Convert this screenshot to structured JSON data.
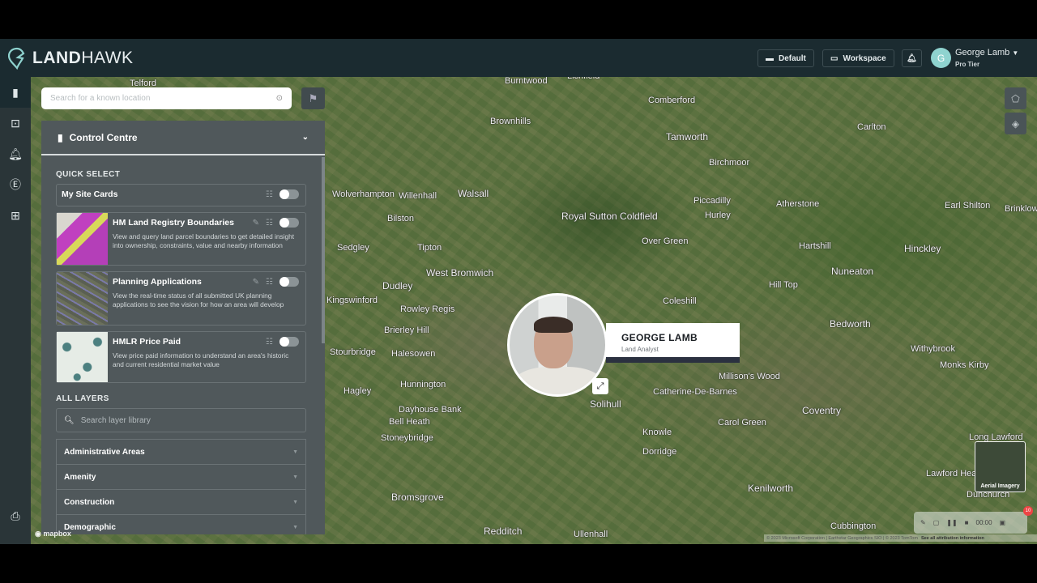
{
  "header": {
    "brand_bold": "LAND",
    "brand_light": "HAWK",
    "default_label": "Default",
    "workspace_label": "Workspace",
    "user_initial": "G",
    "user_name": "George Lamb",
    "user_tier": "Pro Tier"
  },
  "rail": {
    "icons": [
      "map-icon",
      "site-search-icon",
      "alert-icon",
      "pound-icon",
      "grid-icon",
      "print-icon"
    ]
  },
  "search": {
    "placeholder": "Search for a known location"
  },
  "panel": {
    "title": "Control Centre",
    "quick_select_label": "QUICK SELECT",
    "my_site_cards": "My Site Cards",
    "layers": [
      {
        "title": "HM Land Registry Boundaries",
        "desc": "View and query land parcel boundaries to get detailed insight into ownership, constraints, value and nearby information",
        "enabled": false
      },
      {
        "title": "Planning Applications",
        "desc": "View the real-time status of all submitted UK planning applications to see the vision for how an area will develop",
        "enabled": false
      },
      {
        "title": "HMLR Price Paid",
        "desc": "View price paid information to understand an area's historic and current residential market value",
        "enabled": false
      }
    ],
    "all_layers_label": "ALL LAYERS",
    "layer_search_placeholder": "Search layer library",
    "categories": [
      "Administrative Areas",
      "Amenity",
      "Construction",
      "Demographic"
    ]
  },
  "presenter": {
    "name": "GEORGE LAMB",
    "role": "Land Analyst"
  },
  "map": {
    "places": [
      "Telford",
      "Burntwood",
      "Lichfield",
      "Comberford",
      "Carlton",
      "Brownhills",
      "Tamworth",
      "Walsall",
      "Willenhall",
      "Bilston",
      "Royal Sutton Coldfield",
      "Sedgley",
      "Tipton",
      "West Bromwich",
      "Dudley",
      "Rowley Regis",
      "Brierley Hill",
      "Halesowen",
      "Stourbridge",
      "Hagley",
      "Hunnington",
      "Dayhouse Bank",
      "Bell Heath",
      "Stoneybridge",
      "Bromsgrove",
      "Redditch",
      "Ullenhall",
      "Solihull",
      "Knowle",
      "Dorridge",
      "Catherine-De-Barnes",
      "Millison's Wood",
      "Carol Green",
      "Coventry",
      "Kenilworth",
      "Cubbington",
      "Long Lawford",
      "Lawford Heath",
      "Dunchurch",
      "Nuneaton",
      "Bedworth",
      "Hinckley",
      "Atherstone",
      "Hartshill",
      "Earl Shilton",
      "Withybrook",
      "Monks Kirby",
      "Over Green",
      "Piccadilly",
      "Hurley",
      "Birchmoor",
      "Coleshill",
      "Hill Top",
      "Wolverhampton",
      "Kingswinford",
      "Brinklow"
    ],
    "attribution": "© 2023 Microsoft Corporation | Earthstar Geographics SIO | © 2023 TomTom",
    "attribution_link": "See all attribution information",
    "basemap_label": "Aerial Imagery",
    "mapbox_label": "mapbox",
    "recorder_time": "00:00",
    "badge_count": "10"
  }
}
